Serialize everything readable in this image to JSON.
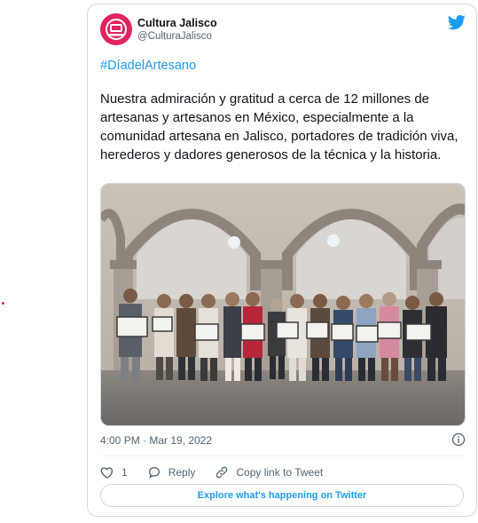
{
  "tweet": {
    "author_name": "Cultura Jalisco",
    "author_handle": "@CulturaJalisco",
    "hashtag": "#DíadelArtesano",
    "text": "Nuestra admiración y gratitud a cerca de 12 millones de artesanas y artesanos en México, especialmente a la comunidad artesana en Jalisco, portadores de tradición viva, herederos y dadores generosos de la técnica y la historia.",
    "timestamp": "4:00 PM · Mar 19, 2022",
    "like_count": "1",
    "reply_label": "Reply",
    "copy_link_label": "Copy link to Tweet",
    "explore_label": "Explore what's happening on Twitter"
  },
  "colors": {
    "accent": "#1d9bf0",
    "avatar": "#e0245e",
    "text_secondary": "#536471",
    "border": "#cfd9de"
  },
  "icons": [
    "twitter-bird-icon",
    "info-icon",
    "heart-icon",
    "reply-bubble-icon",
    "link-icon"
  ]
}
